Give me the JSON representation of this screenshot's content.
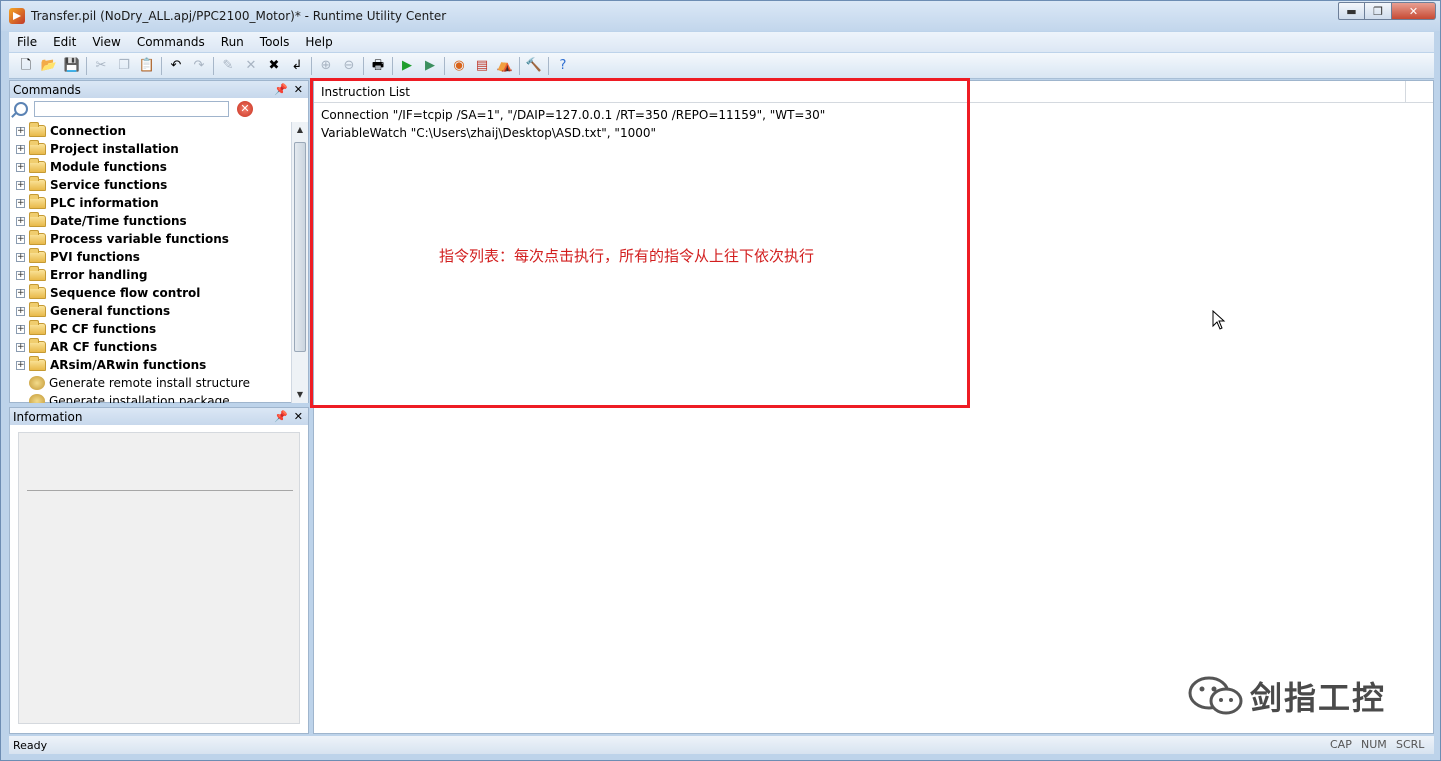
{
  "window": {
    "title": "Transfer.pil (NoDry_ALL.apj/PPC2100_Motor)* - Runtime Utility Center",
    "controls": {
      "minimize": "▬",
      "maximize": "❐",
      "close": "✕"
    }
  },
  "menu": [
    "File",
    "Edit",
    "View",
    "Commands",
    "Run",
    "Tools",
    "Help"
  ],
  "toolbar_icons": [
    {
      "name": "new-icon",
      "glyph": "🗋",
      "enabled": true
    },
    {
      "name": "open-icon",
      "glyph": "📂",
      "enabled": true
    },
    {
      "name": "save-icon",
      "glyph": "💾",
      "enabled": true
    },
    {
      "sep": true
    },
    {
      "name": "cut-icon",
      "glyph": "✂",
      "enabled": false
    },
    {
      "name": "copy-icon",
      "glyph": "❐",
      "enabled": false
    },
    {
      "name": "paste-icon",
      "glyph": "📋",
      "enabled": false
    },
    {
      "sep": true
    },
    {
      "name": "undo-icon",
      "glyph": "↶",
      "enabled": true
    },
    {
      "name": "redo-icon",
      "glyph": "↷",
      "enabled": false
    },
    {
      "sep": true
    },
    {
      "name": "edit-icon",
      "glyph": "✎",
      "enabled": false
    },
    {
      "name": "delete-icon",
      "glyph": "✕",
      "enabled": false
    },
    {
      "name": "delete-all-icon",
      "glyph": "✖",
      "enabled": true
    },
    {
      "name": "enter-icon",
      "glyph": "↲",
      "enabled": true
    },
    {
      "sep": true
    },
    {
      "name": "zoom-in-icon",
      "glyph": "⊕",
      "enabled": false
    },
    {
      "name": "zoom-out-icon",
      "glyph": "⊖",
      "enabled": false
    },
    {
      "sep": true
    },
    {
      "name": "print-icon",
      "glyph": "🖶",
      "enabled": true
    },
    {
      "sep": true
    },
    {
      "name": "run-icon",
      "glyph": "▶",
      "enabled": true,
      "color": "#1f9e2c"
    },
    {
      "name": "run-step-icon",
      "glyph": "▶",
      "enabled": true,
      "color": "#3b8f5e"
    },
    {
      "sep": true
    },
    {
      "name": "target-icon",
      "glyph": "◉",
      "enabled": true,
      "color": "#d9641a"
    },
    {
      "name": "notebook-icon",
      "glyph": "▤",
      "enabled": true,
      "color": "#c0392b"
    },
    {
      "name": "package-icon",
      "glyph": "⛺",
      "enabled": true,
      "color": "#a0782a"
    },
    {
      "sep": true
    },
    {
      "name": "hammer-icon",
      "glyph": "🔨",
      "enabled": true
    },
    {
      "sep": true
    },
    {
      "name": "help-icon",
      "glyph": "?",
      "enabled": true,
      "color": "#2f6fd1"
    }
  ],
  "commands_panel": {
    "title": "Commands",
    "search_placeholder": "",
    "items": [
      {
        "label": "Connection",
        "bold": true,
        "folder": true
      },
      {
        "label": "Project installation",
        "bold": true,
        "folder": true
      },
      {
        "label": "Module functions",
        "bold": true,
        "folder": true
      },
      {
        "label": "Service functions",
        "bold": true,
        "folder": true
      },
      {
        "label": "PLC information",
        "bold": true,
        "folder": true
      },
      {
        "label": "Date/Time functions",
        "bold": true,
        "folder": true
      },
      {
        "label": "Process variable functions",
        "bold": true,
        "folder": true
      },
      {
        "label": "PVI functions",
        "bold": true,
        "folder": true
      },
      {
        "label": "Error handling",
        "bold": true,
        "folder": true
      },
      {
        "label": "Sequence flow control",
        "bold": true,
        "folder": true
      },
      {
        "label": "General functions",
        "bold": true,
        "folder": true
      },
      {
        "label": "PC CF functions",
        "bold": true,
        "folder": true
      },
      {
        "label": "AR CF functions",
        "bold": true,
        "folder": true
      },
      {
        "label": "ARsim/ARwin functions",
        "bold": true,
        "folder": true
      },
      {
        "label": "Generate remote install structure",
        "bold": false,
        "folder": false
      },
      {
        "label": "Generate installation package",
        "bold": false,
        "folder": false
      }
    ]
  },
  "information_panel": {
    "title": "Information"
  },
  "instruction_list": {
    "header": "Instruction List",
    "rows": [
      "Connection \"/IF=tcpip /SA=1\", \"/DAIP=127.0.0.1 /RT=350 /REPO=11159\", \"WT=30\"",
      "VariableWatch \"C:\\Users\\zhaij\\Desktop\\ASD.txt\", \"1000\""
    ],
    "annotation": "指令列表：每次点击执行，所有的指令从上往下依次执行"
  },
  "watermark": "剑指工控",
  "status": {
    "text": "Ready",
    "indicators": [
      "CAP",
      "NUM",
      "SCRL"
    ]
  },
  "colors": {
    "annotation_red": "#ee1c24",
    "frame_blue": "#bdd3ea"
  }
}
